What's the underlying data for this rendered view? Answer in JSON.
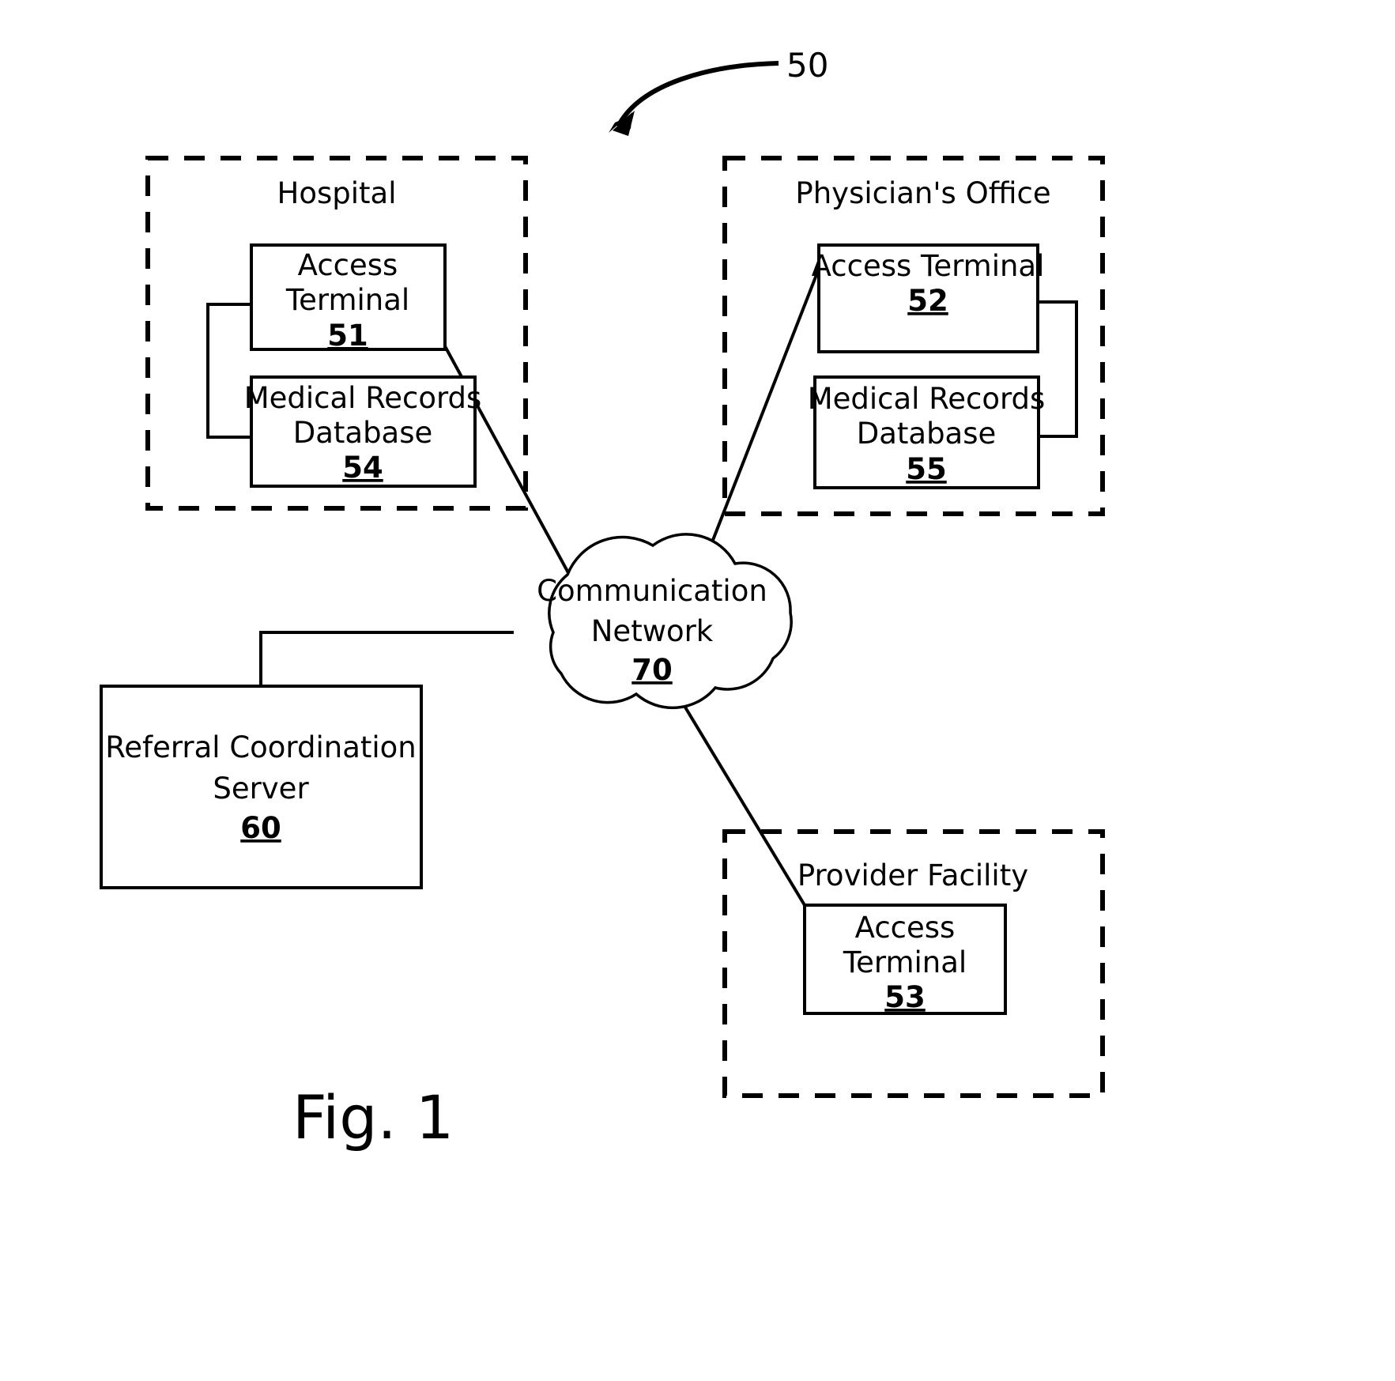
{
  "figure": {
    "caption": "Fig. 1",
    "system_reference": "50"
  },
  "groups": [
    {
      "id": "hospital",
      "label": "Hospital",
      "boxes": [
        {
          "id": "access-terminal-51",
          "line1": "Access",
          "line2": "Terminal",
          "ref": "51"
        },
        {
          "id": "medical-records-database-54",
          "line1": "Medical Records",
          "line2": "Database",
          "ref": "54"
        }
      ]
    },
    {
      "id": "physicians-office",
      "label": "Physician's Office",
      "boxes": [
        {
          "id": "access-terminal-52",
          "line1": "Access Terminal",
          "line2": "",
          "ref": "52"
        },
        {
          "id": "medical-records-database-55",
          "line1": "Medical Records",
          "line2": "Database",
          "ref": "55"
        }
      ]
    },
    {
      "id": "provider-facility",
      "label": "Provider Facility",
      "boxes": [
        {
          "id": "access-terminal-53",
          "line1": "Access",
          "line2": "Terminal",
          "ref": "53"
        }
      ]
    }
  ],
  "nodes": {
    "referral_server": {
      "line1": "Referral Coordination",
      "line2": "Server",
      "ref": "60"
    },
    "network_cloud": {
      "line1": "Communication",
      "line2": "Network",
      "ref": "70"
    }
  },
  "colors": {
    "stroke": "#000000",
    "background": "#ffffff"
  }
}
